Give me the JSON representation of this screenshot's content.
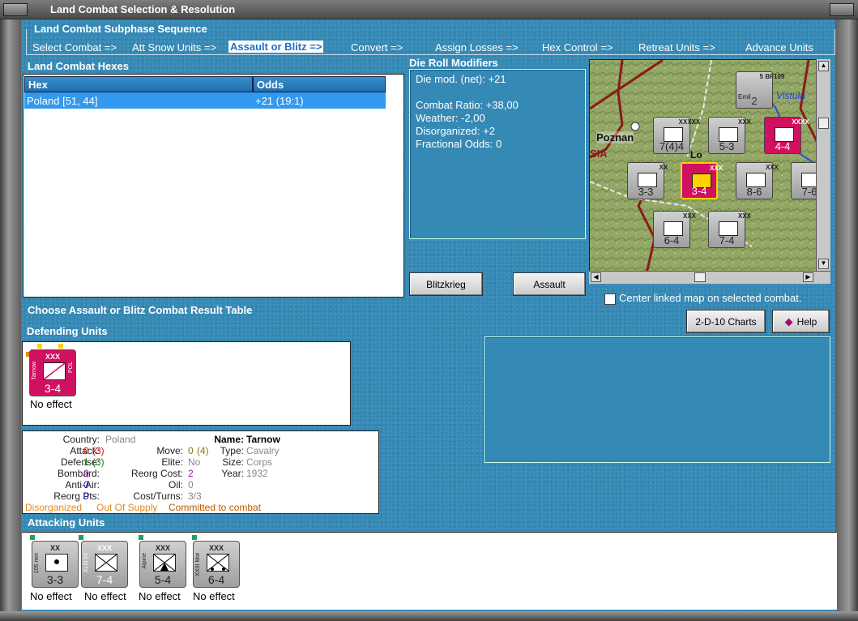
{
  "window": {
    "title": "Land Combat Selection & Resolution"
  },
  "subphase": {
    "title": "Land Combat Subphase Sequence",
    "steps": [
      "Select Combat =>",
      "Att Snow Units =>",
      "Assault or Blitz =>",
      "Convert =>",
      "Assign Losses =>",
      "Hex Control =>",
      "Retreat Units =>",
      "Advance Units"
    ],
    "active_index": 2
  },
  "hexes": {
    "title": "Land Combat Hexes",
    "columns": [
      "Hex",
      "Odds"
    ],
    "rows": [
      {
        "hex": "Poland [51, 44]",
        "odds": "+21 (19:1)"
      }
    ]
  },
  "die_roll": {
    "title": "Die Roll Modifiers",
    "net": "Die mod. (net): +21",
    "lines": [
      "Combat Ratio: +38,00",
      "Weather: -2,00",
      "Disorganized: +2",
      "Fractional Odds: 0"
    ]
  },
  "buttons": {
    "blitzkrieg": "Blitzkrieg",
    "assault": "Assault",
    "charts": "2-D-10 Charts",
    "help": "Help"
  },
  "center_map": {
    "label": "Center linked map on selected combat."
  },
  "choose_label": "Choose Assault or Blitz Combat Result Table",
  "map": {
    "cities": [
      "Poznan",
      "Vistula",
      "SIA",
      "Lo"
    ],
    "counters": [
      {
        "size": "5 BF109",
        "value": "2",
        "kind": "grey",
        "extra": "Emil"
      },
      {
        "size": "XXXXX",
        "value": "7(4)4",
        "kind": "grey"
      },
      {
        "size": "XXX",
        "value": "5-3",
        "kind": "grey"
      },
      {
        "size": "XXXX",
        "value": "4-4",
        "kind": "red"
      },
      {
        "size": "XX",
        "value": "3-3",
        "kind": "grey"
      },
      {
        "size": "XXX",
        "value": "3-4",
        "kind": "red"
      },
      {
        "size": "XXX",
        "value": "8-6",
        "kind": "grey"
      },
      {
        "size": "XXX",
        "value": "7-6",
        "kind": "grey"
      },
      {
        "size": "XXX",
        "value": "6-4",
        "kind": "grey"
      },
      {
        "size": "XXX",
        "value": "7-4",
        "kind": "grey"
      }
    ]
  },
  "defending": {
    "title": "Defending Units",
    "units": [
      {
        "size": "XXX",
        "name": "Tarnow",
        "nation": "POL",
        "value": "3-4",
        "result": "No effect"
      }
    ]
  },
  "info": {
    "country_label": "Country:",
    "country": "Poland",
    "attack_label": "Attack:",
    "attack": "0",
    "attack_paren": "(3)",
    "defense_label": "Defense:",
    "defense": "1",
    "defense_paren": "(3)",
    "bombard_label": "Bombard:",
    "bombard": "0",
    "antiair_label": "Anti-Air:",
    "antiair": "0",
    "reorgpts_label": "Reorg Pts:",
    "reorgpts": "0",
    "move_label": "Move:",
    "move": "0",
    "move_paren": "(4)",
    "elite_label": "Elite:",
    "elite": "No",
    "reorgcost_label": "Reorg Cost:",
    "reorgcost": "2",
    "oil_label": "Oil:",
    "oil": "0",
    "costturns_label": "Cost/Turns:",
    "costturns": "3/3",
    "name_label": "Name:",
    "name": "Tarnow",
    "type_label": "Type:",
    "type": "Cavalry",
    "size_label": "Size:",
    "size": "Corps",
    "year_label": "Year:",
    "year": "1932",
    "status": [
      "Disorganized",
      "Out Of Supply",
      "Committed to combat"
    ]
  },
  "attacking": {
    "title": "Attacking Units",
    "units": [
      {
        "size": "XX",
        "name": "105 mm",
        "value": "3-3",
        "result": "No effect"
      },
      {
        "size": "XXX",
        "name": "XLIII Inf",
        "value": "7-4",
        "result": "No effect"
      },
      {
        "size": "XXX",
        "name": "Alpine",
        "value": "5-4",
        "result": "No effect"
      },
      {
        "size": "XXX",
        "name": "XXIII Mot",
        "value": "6-4",
        "result": "No effect"
      }
    ]
  },
  "colors": {
    "panel_blue": "#3589b5",
    "header_blue": "#2a7fbf",
    "selected_row": "#3399ee",
    "axis_red": "#d01060",
    "active_step": "#1a73c8"
  }
}
